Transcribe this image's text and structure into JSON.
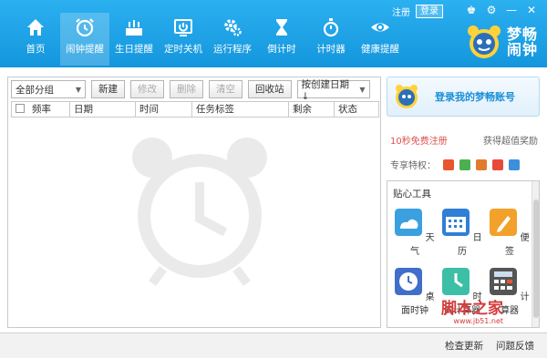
{
  "nav": {
    "items": [
      {
        "label": "首页",
        "icon": "home-icon"
      },
      {
        "label": "闹钟提醒",
        "icon": "alarm-icon"
      },
      {
        "label": "生日提醒",
        "icon": "birthday-cake-icon"
      },
      {
        "label": "定时关机",
        "icon": "power-icon"
      },
      {
        "label": "运行程序",
        "icon": "gear-icon"
      },
      {
        "label": "倒计时",
        "icon": "hourglass-icon"
      },
      {
        "label": "计时器",
        "icon": "stopwatch-icon"
      },
      {
        "label": "健康提醒",
        "icon": "eye-icon"
      }
    ],
    "active_index": 1
  },
  "header": {
    "register": "注册",
    "login": "登录",
    "logo_line1": "梦畅",
    "logo_line2": "闹钟"
  },
  "toolbar": {
    "group_select": "全部分组",
    "new_label": "新建",
    "edit_label": "修改",
    "delete_label": "删除",
    "clear_label": "清空",
    "recycle_label": "回收站",
    "sort_select": "按创建日期↓"
  },
  "table": {
    "columns": [
      "频率",
      "日期",
      "时间",
      "任务标签",
      "剩余",
      "状态"
    ]
  },
  "account": {
    "login_prompt": "登录我的梦畅账号",
    "free_register": "10秒免费注册",
    "reward": "获得超值奖励",
    "perks_label": "专享特权："
  },
  "tools": {
    "title": "贴心工具",
    "items": [
      {
        "label": "天气",
        "icon": "weather-icon",
        "color": "#3aa0e0"
      },
      {
        "label": "日历",
        "icon": "calendar-icon",
        "color": "#2f7fd6"
      },
      {
        "label": "便签",
        "icon": "note-icon",
        "color": "#f2a12a"
      },
      {
        "label": "桌面时钟",
        "icon": "desktop-clock-icon",
        "color": "#3f6fc8"
      },
      {
        "label": "时间计算器",
        "icon": "time-calculator-icon",
        "color": "#3cbfa6"
      },
      {
        "label": "计算器",
        "icon": "calculator-icon",
        "color": "#555555"
      }
    ]
  },
  "status": {
    "check_update": "检查更新",
    "feedback": "问题反馈",
    "watermark_text": "脚本之家",
    "watermark_url": "www.jb51.net"
  },
  "colors": {
    "header_blue": "#1aa2e8",
    "accent_red": "#e05050"
  }
}
